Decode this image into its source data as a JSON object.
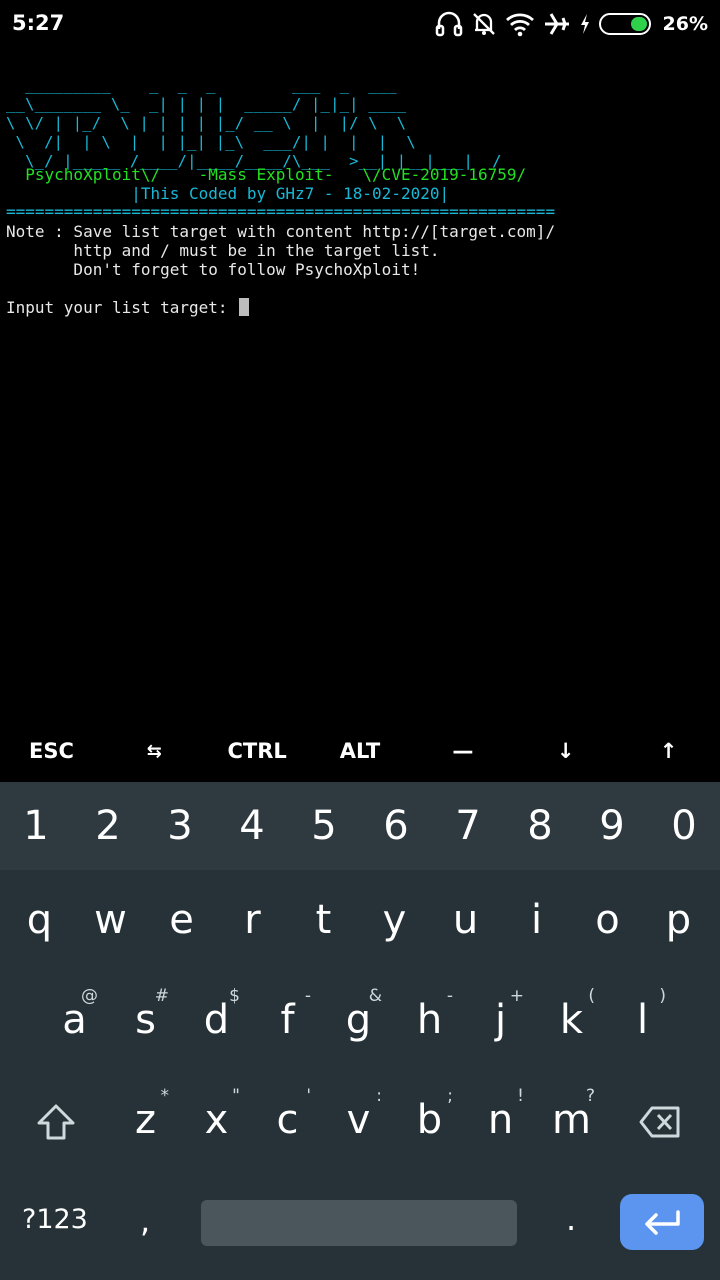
{
  "status_bar": {
    "time": "5:27",
    "battery_percent": "26%",
    "battery_level": 0.26,
    "icons": [
      "headset-icon",
      "mute-icon",
      "wifi-icon",
      "airplane-icon",
      "charging-icon",
      "battery-icon"
    ]
  },
  "terminal": {
    "banner_art": "  _________    _  _  _        ___  _  ___  \n__\\_______ \\_  _| | | |  _____/ |_|_| ____\n\\ \\/ | |_/  \\ | | | | |_/ __ \\  |  |/ \\  \\\n \\  /|  | \\  |  | |_| |_\\  ___/| |  |  |  \\\n  \\_/ |_____ /____/|____/____/\\___  >__| |__|___|  /",
    "banner_line": "  PsychoXploit\\/    -Mass Exploit-   \\/CVE-2019-16759/",
    "credit_line": "             |This Coded by GHz7 - 18-02-2020|",
    "separator": "=========================================================",
    "note_lines": [
      "Note : Save list target with content http://[target.com]/",
      "       http and / must be in the target list.",
      "       Don't forget to follow PsychoXploit!"
    ],
    "prompt": "Input your list target: "
  },
  "extra_keys": [
    "ESC",
    "⇆",
    "CTRL",
    "ALT",
    "—",
    "↓",
    "↑"
  ],
  "keyboard": {
    "number_row": [
      "1",
      "2",
      "3",
      "4",
      "5",
      "6",
      "7",
      "8",
      "9",
      "0"
    ],
    "row1": [
      {
        "key": "q",
        "hint": ""
      },
      {
        "key": "w",
        "hint": ""
      },
      {
        "key": "e",
        "hint": ""
      },
      {
        "key": "r",
        "hint": ""
      },
      {
        "key": "t",
        "hint": ""
      },
      {
        "key": "y",
        "hint": ""
      },
      {
        "key": "u",
        "hint": ""
      },
      {
        "key": "i",
        "hint": ""
      },
      {
        "key": "o",
        "hint": ""
      },
      {
        "key": "p",
        "hint": ""
      }
    ],
    "row2": [
      {
        "key": "a",
        "hint": "@"
      },
      {
        "key": "s",
        "hint": "#"
      },
      {
        "key": "d",
        "hint": "$"
      },
      {
        "key": "f",
        "hint": "-"
      },
      {
        "key": "g",
        "hint": "&"
      },
      {
        "key": "h",
        "hint": "-"
      },
      {
        "key": "j",
        "hint": "+"
      },
      {
        "key": "k",
        "hint": "("
      },
      {
        "key": "l",
        "hint": ")"
      }
    ],
    "row3": [
      {
        "key": "z",
        "hint": "*"
      },
      {
        "key": "x",
        "hint": "\""
      },
      {
        "key": "c",
        "hint": "'"
      },
      {
        "key": "v",
        "hint": ":"
      },
      {
        "key": "b",
        "hint": ";"
      },
      {
        "key": "n",
        "hint": "!"
      },
      {
        "key": "m",
        "hint": "?"
      }
    ],
    "symbols_label": "?123",
    "comma": ",",
    "period": ".",
    "colors": {
      "background": "#263238",
      "number_row": "#2e3a40",
      "enter": "#5b95f0"
    }
  }
}
